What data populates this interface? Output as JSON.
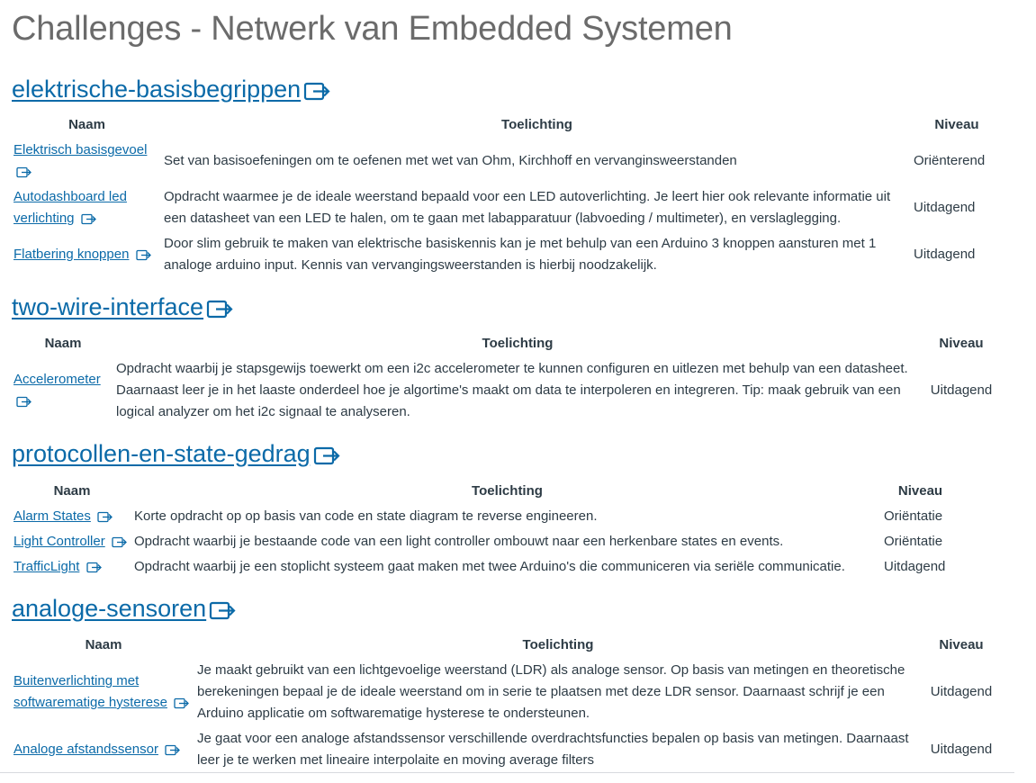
{
  "page": {
    "title": "Challenges - Netwerk van Embedded Systemen"
  },
  "headers": {
    "name": "Naam",
    "description": "Toelichting",
    "level": "Niveau"
  },
  "icons": {
    "external_link": "external-link-icon"
  },
  "colors": {
    "link": "#0b6aa8",
    "title": "#6b6b6b",
    "text": "#2d3b45"
  },
  "sections": [
    {
      "heading": "elektrische-basisbegrippen",
      "rows": [
        {
          "name": "Elektrisch basisgevoel",
          "description": "Set van basisoefeningen om te oefenen met wet van Ohm, Kirchhoff en vervanginsweerstanden",
          "level": "Oriënterend"
        },
        {
          "name": "Autodashboard led verlichting",
          "description": "Opdracht waarmee je de ideale weerstand bepaald voor een LED autoverlichting. Je leert hier ook relevante informatie uit een datasheet van een LED te halen, om te gaan met labapparatuur (labvoeding / multimeter), en verslaglegging.",
          "level": "Uitdagend"
        },
        {
          "name": "Flatbering knoppen",
          "description": "Door slim gebruik te maken van elektrische basiskennis kan je met behulp van een Arduino 3 knoppen aansturen met 1 analoge arduino input. Kennis van vervangingsweerstanden is hierbij noodzakelijk.",
          "level": "Uitdagend"
        }
      ]
    },
    {
      "heading": "two-wire-interface",
      "rows": [
        {
          "name": "Accelerometer",
          "description": "Opdracht waarbij je stapsgewijs toewerkt om een i2c accelerometer te kunnen configuren en uitlezen met behulp van een datasheet. Daarnaast leer je in het laaste onderdeel hoe je algortime's maakt om data te interpoleren en integreren. Tip: maak gebruik van een logical analyzer om het i2c signaal te analyseren.",
          "level": "Uitdagend"
        }
      ]
    },
    {
      "heading": "protocollen-en-state-gedrag",
      "rows": [
        {
          "name": "Alarm States",
          "description": "Korte opdracht op op basis van code en state diagram te reverse engineeren.",
          "level": "Oriëntatie"
        },
        {
          "name": "Light Controller",
          "description": "Opdracht waarbij je bestaande code van een light controller ombouwt naar een herkenbare states en events.",
          "level": "Oriëntatie"
        },
        {
          "name": "TrafficLight",
          "description": "Opdracht waarbij je een stoplicht systeem gaat maken met twee Arduino's die communiceren via seriële communicatie.",
          "level": "Uitdagend"
        }
      ]
    },
    {
      "heading": "analoge-sensoren",
      "rows": [
        {
          "name": "Buitenverlichting met softwarematige hysterese",
          "description": "Je maakt gebruikt van een lichtgevoelige weerstand (LDR) als analoge sensor. Op basis van metingen en theoretische berekeningen bepaal je de ideale weerstand om in serie te plaatsen met deze LDR sensor. Daarnaast schrijf je een Arduino applicatie om softwarematige hysterese te ondersteunen.",
          "level": "Uitdagend"
        },
        {
          "name": "Analoge afstandssensor",
          "description": "Je gaat voor een analoge afstandssensor verschillende overdrachtsfuncties bepalen op basis van metingen. Daarnaast leer je te werken met lineaire interpolaite en moving average filters",
          "level": "Uitdagend"
        }
      ]
    }
  ]
}
